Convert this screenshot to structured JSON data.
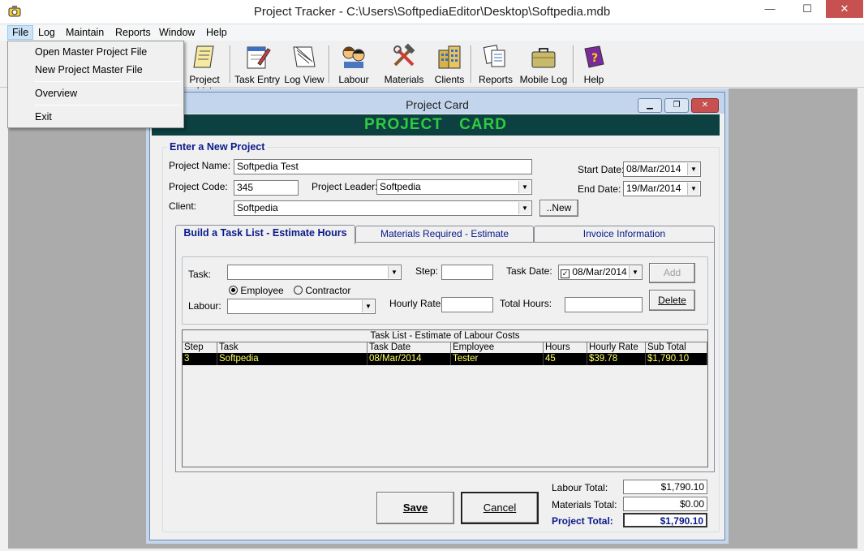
{
  "app": {
    "title": "Project Tracker - C:\\Users\\SoftpediaEditor\\Desktop\\Softpedia.mdb",
    "minimize": "—",
    "maximize": "☐",
    "close": "✕"
  },
  "menubar": [
    "File",
    "Log",
    "Maintain",
    "Reports",
    "Window",
    "Help"
  ],
  "file_menu": {
    "items": [
      "Open Master Project File",
      "New Project Master File",
      "Overview",
      "Exit"
    ]
  },
  "toolbar": [
    "Project List",
    "Task Entry",
    "Log View",
    "Labour",
    "Materials",
    "Clients",
    "Reports",
    "Mobile Log",
    "Help"
  ],
  "card": {
    "title": "Project Card",
    "banner": "PROJECT CARD",
    "group_title": "Enter a New Project",
    "project_name_label": "Project Name:",
    "project_name": "Softpedia Test",
    "project_code_label": "Project Code:",
    "project_code": "345",
    "project_leader_label": "Project Leader:",
    "project_leader": "Softpedia",
    "client_label": "Client:",
    "client": "Softpedia",
    "new_button": "..New",
    "start_date_label": "Start Date:",
    "start_date": "08/Mar/2014",
    "end_date_label": "End Date:",
    "end_date": "19/Mar/2014",
    "tabs": [
      "Build a Task List - Estimate Hours",
      "Materials Required - Estimate",
      "Invoice Information"
    ],
    "task_label": "Task:",
    "task_value": "",
    "step_label": "Step:",
    "step_value": "",
    "task_date_label": "Task Date:",
    "task_date": "08/Mar/2014",
    "add_button": "Add",
    "employee_radio": "Employee",
    "contractor_radio": "Contractor",
    "labour_label": "Labour:",
    "hourly_rate_label": "Hourly Rate:",
    "total_hours_label": "Total Hours:",
    "delete_button": "Delete",
    "grid_caption": "Task List - Estimate of Labour Costs",
    "grid_columns": [
      "Step",
      "Task",
      "Task Date",
      "Employee",
      "Hours",
      "Hourly Rate",
      "Sub Total"
    ],
    "grid_rows": [
      [
        "3",
        "Softpedia",
        "08/Mar/2014",
        "Tester",
        "45",
        "$39.78",
        "$1,790.10"
      ]
    ],
    "save_button": "Save",
    "cancel_button": "Cancel",
    "labour_total_label": "Labour Total:",
    "labour_total": "$1,790.10",
    "materials_total_label": "Materials Total:",
    "materials_total": "$0.00",
    "project_total_label": "Project Total:",
    "project_total": "$1,790.10"
  },
  "colors": {
    "banner_bg": "#0d4040",
    "banner_text": "#2ecc40",
    "row_bg": "#000000",
    "row_text": "#ffff60",
    "label_blue": "#0a1a8a"
  }
}
